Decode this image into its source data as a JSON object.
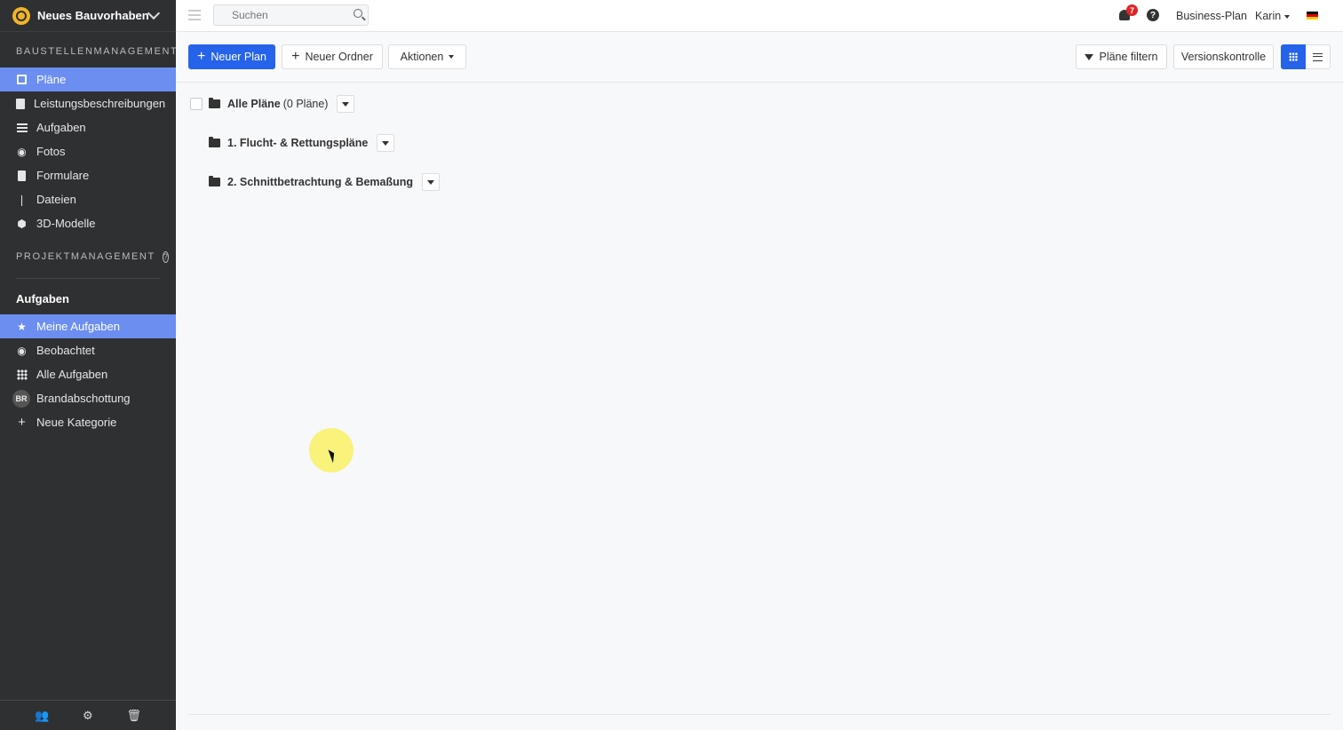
{
  "project": {
    "title": "Neues Bauvorhaben"
  },
  "sidebar": {
    "section_baustelle": "BAUSTELLENMANAGEMENT",
    "items": [
      {
        "label": "Pläne",
        "icon": "plans-icon",
        "active": true
      },
      {
        "label": "Leistungsbeschreibungen",
        "icon": "document-icon"
      },
      {
        "label": "Aufgaben",
        "icon": "list-icon"
      },
      {
        "label": "Fotos",
        "icon": "camera-icon"
      },
      {
        "label": "Formulare",
        "icon": "clipboard-icon"
      },
      {
        "label": "Dateien",
        "icon": "paperclip-icon"
      },
      {
        "label": "3D-Modelle",
        "icon": "cube-icon"
      }
    ],
    "section_projekt": "PROJEKTMANAGEMENT",
    "tasks_header": "Aufgaben",
    "task_items": [
      {
        "label": "Meine Aufgaben",
        "icon": "star-icon",
        "active": true
      },
      {
        "label": "Beobachtet",
        "icon": "eye-icon"
      },
      {
        "label": "Alle Aufgaben",
        "icon": "grid-icon"
      },
      {
        "label": "Brandabschottung",
        "badge": "BR"
      },
      {
        "label": "Neue Kategorie",
        "icon": "plus-icon"
      }
    ]
  },
  "topbar": {
    "search_placeholder": "Suchen",
    "notifications_count": "7",
    "help_label": "?",
    "plan_label": "Business-Plan",
    "user_name": "Karin"
  },
  "toolbar": {
    "new_plan": "Neuer Plan",
    "new_folder": "Neuer Ordner",
    "actions": "Aktionen",
    "filter": "Pläne filtern",
    "version_control": "Versionskontrolle"
  },
  "tree": {
    "root_label": "Alle Pläne",
    "root_count": "(0 Pläne)",
    "folders": [
      {
        "label": "1. Flucht- & Rettungspläne"
      },
      {
        "label": "2. Schnittbetrachtung & Bemaßung"
      }
    ]
  },
  "colors": {
    "accent": "#2563eb",
    "sidebar_bg": "#2f3032",
    "sidebar_active": "#6b8ef0"
  }
}
